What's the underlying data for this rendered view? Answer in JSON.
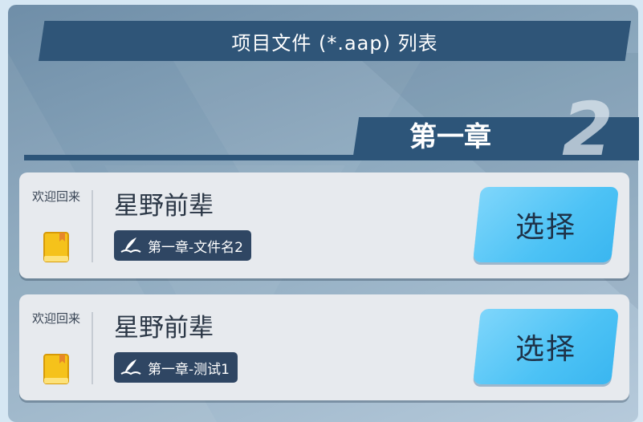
{
  "header": {
    "title": "项目文件 (*.aap) 列表"
  },
  "chapter": {
    "label": "第一章",
    "number": "2"
  },
  "cards": [
    {
      "welcome": "欢迎回来",
      "book_icon": "book-icon",
      "player_name": "星野前辈",
      "file_icon": "feather-book-icon",
      "file_name": "第一章-文件名2",
      "select_label": "选择"
    },
    {
      "welcome": "欢迎回来",
      "book_icon": "book-icon",
      "player_name": "星野前辈",
      "file_icon": "feather-book-icon",
      "file_name": "第一章-测试1",
      "select_label": "选择"
    }
  ],
  "colors": {
    "header_bg": "#2f5578",
    "card_bg": "#e7eaee",
    "button_bg": "#4cc2f5",
    "tag_bg": "#2f4663"
  }
}
